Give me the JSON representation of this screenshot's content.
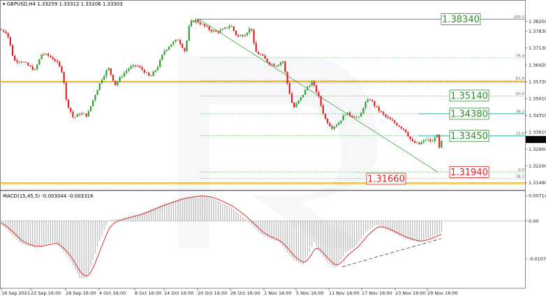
{
  "header": {
    "symbol_line": "GBPUSD,H4  1.33259 1.33312 1.33206 1.33303",
    "macd_line": "MACD(15,45,5) -0.003044 -0.003316"
  },
  "colors": {
    "bull": "#2e9e2e",
    "bear": "#e02020",
    "orange": "#f5a400",
    "teal": "#38b8a8",
    "fib": "#2e9e2e",
    "hist": "#b8b8b8",
    "signal": "#e03030",
    "trend": "#2e9e2e",
    "label_green": "#2e8b2e",
    "label_red": "#e02020",
    "price_box": "#000000"
  },
  "chart_data": [
    {
      "type": "candlestick",
      "title": "GBPUSD,H4",
      "ohlc_readout": [
        "1.33259",
        "1.33312",
        "1.33206",
        "1.33303"
      ],
      "ylim": [
        1.3125,
        1.3885
      ],
      "y_ticks": [
        "1.38250",
        "1.37830",
        "1.37130",
        "1.36420",
        "1.35720",
        "1.35010",
        "1.34310",
        "1.33610",
        "1.32900",
        "1.32200",
        "1.31490"
      ],
      "x_ticks": [
        "16 Sep 2021",
        "22 Sep 16:00",
        "28 Sep 16:00",
        "4 Oct 16:00",
        "8 Oct 16:00",
        "14 Oct 16:00",
        "20 Oct 16:00",
        "26 Oct 16:00",
        "1 Nov 16:00",
        "5 Nov 16:00",
        "11 Nov 16:00",
        "17 Nov 16:00",
        "23 Nov 16:00",
        "29 Nov 16:00"
      ],
      "current_price": "1.33303",
      "price_path": [
        [
          0,
          1.379
        ],
        [
          10,
          1.378
        ],
        [
          20,
          1.366
        ],
        [
          30,
          1.366
        ],
        [
          40,
          1.364
        ],
        [
          50,
          1.362
        ],
        [
          60,
          1.369
        ],
        [
          70,
          1.368
        ],
        [
          80,
          1.366
        ],
        [
          90,
          1.361
        ],
        [
          95,
          1.349
        ],
        [
          105,
          1.342
        ],
        [
          115,
          1.344
        ],
        [
          125,
          1.343
        ],
        [
          135,
          1.351
        ],
        [
          145,
          1.358
        ],
        [
          155,
          1.363
        ],
        [
          165,
          1.356
        ],
        [
          175,
          1.36
        ],
        [
          185,
          1.363
        ],
        [
          195,
          1.364
        ],
        [
          205,
          1.362
        ],
        [
          215,
          1.359
        ],
        [
          225,
          1.363
        ],
        [
          235,
          1.37
        ],
        [
          245,
          1.373
        ],
        [
          255,
          1.375
        ],
        [
          265,
          1.37
        ],
        [
          272,
          1.382
        ],
        [
          280,
          1.383
        ],
        [
          290,
          1.381
        ],
        [
          300,
          1.379
        ],
        [
          310,
          1.378
        ],
        [
          320,
          1.379
        ],
        [
          330,
          1.381
        ],
        [
          340,
          1.376
        ],
        [
          350,
          1.377
        ],
        [
          360,
          1.38
        ],
        [
          365,
          1.37
        ],
        [
          375,
          1.368
        ],
        [
          385,
          1.365
        ],
        [
          395,
          1.364
        ],
        [
          405,
          1.366
        ],
        [
          412,
          1.356
        ],
        [
          420,
          1.346
        ],
        [
          430,
          1.35
        ],
        [
          440,
          1.355
        ],
        [
          447,
          1.357
        ],
        [
          455,
          1.352
        ],
        [
          465,
          1.342
        ],
        [
          475,
          1.338
        ],
        [
          485,
          1.34
        ],
        [
          495,
          1.344
        ],
        [
          505,
          1.343
        ],
        [
          515,
          1.342
        ],
        [
          522,
          1.348
        ],
        [
          530,
          1.35
        ],
        [
          540,
          1.346
        ],
        [
          550,
          1.343
        ],
        [
          560,
          1.341
        ],
        [
          570,
          1.339
        ],
        [
          580,
          1.337
        ],
        [
          590,
          1.332
        ],
        [
          600,
          1.331
        ],
        [
          610,
          1.333
        ],
        [
          620,
          1.332
        ],
        [
          625,
          1.336
        ],
        [
          630,
          1.328
        ],
        [
          633,
          1.333
        ]
      ],
      "horizontal_levels": [
        {
          "price": 1.3572,
          "style": "orange"
        },
        {
          "price": 1.3148,
          "style": "orange"
        },
        {
          "price": 1.3834,
          "style": "teal"
        },
        {
          "price": 1.3438,
          "style": "teal"
        },
        {
          "price": 1.3345,
          "style": "teal"
        }
      ],
      "level_labels": [
        {
          "text": "1.38340",
          "price": 1.3834,
          "color": "green"
        },
        {
          "text": "1.35140",
          "price": 1.3514,
          "color": "green"
        },
        {
          "text": "1.34380",
          "price": 1.3438,
          "color": "green"
        },
        {
          "text": "1.33450",
          "price": 1.3345,
          "color": "green"
        },
        {
          "text": "1.31940",
          "price": 1.3194,
          "color": "red"
        },
        {
          "text": "1.31660",
          "price": 1.3166,
          "color": "red"
        }
      ],
      "fibonacci_levels": [
        {
          "label": "100.0",
          "price": 1.3834
        },
        {
          "label": "76.4",
          "price": 1.3672
        },
        {
          "label": "61.8",
          "price": 1.3576
        },
        {
          "label": "50.0",
          "price": 1.3513
        },
        {
          "label": "38.2",
          "price": 1.3438
        },
        {
          "label": "23.6",
          "price": 1.3345
        },
        {
          "label": "0.0",
          "price": 1.3194
        },
        {
          "label": "38.2",
          "price": 1.3166
        }
      ]
    },
    {
      "type": "histogram",
      "title": "MACD(15,45,5)",
      "values_readout": [
        "-0.003044",
        "-0.003316"
      ],
      "ylim": [
        -0.0185,
        0.008
      ],
      "y_ticks": [
        "0.007149",
        "0.00",
        "-0.010776"
      ],
      "zero_line": 0
    }
  ]
}
